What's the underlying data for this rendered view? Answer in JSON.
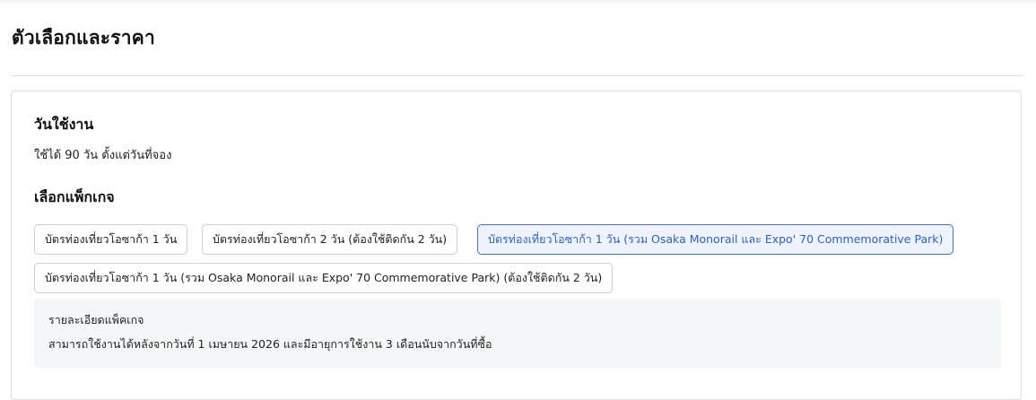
{
  "page": {
    "title": "ตัวเลือกและราคา"
  },
  "validity": {
    "heading": "วันใช้งาน",
    "text": "ใช้ได้ 90 วัน ตั้งแต่วันที่จอง"
  },
  "packages": {
    "heading": "เลือกแพ็กเกจ",
    "options": [
      {
        "label": "บัตรท่องเที่ยวโอซาก้า 1 วัน",
        "selected": false
      },
      {
        "label": "บัตรท่องเที่ยวโอซาก้า 2 วัน (ต้องใช้ติดกัน 2 วัน)",
        "selected": false
      },
      {
        "label": "บัตรท่องเที่ยวโอซาก้า 1 วัน (รวม Osaka Monorail และ Expo' 70 Commemorative Park)",
        "selected": true
      },
      {
        "label": "บัตรท่องเที่ยวโอซาก้า 1 วัน (รวม Osaka Monorail และ Expo' 70 Commemorative Park) (ต้องใช้ติดกัน 2 วัน)",
        "selected": false
      }
    ],
    "selected_color": "#3f6fd8"
  },
  "details": {
    "title": "รายละเอียดแพ็คเกจ",
    "text": "สามารถใช้งานได้หลังจากวันที่ 1 เมษายน 2026 และมีอายุการใช้งาน 3 เดือนนับจากวันที่ซื้อ"
  }
}
